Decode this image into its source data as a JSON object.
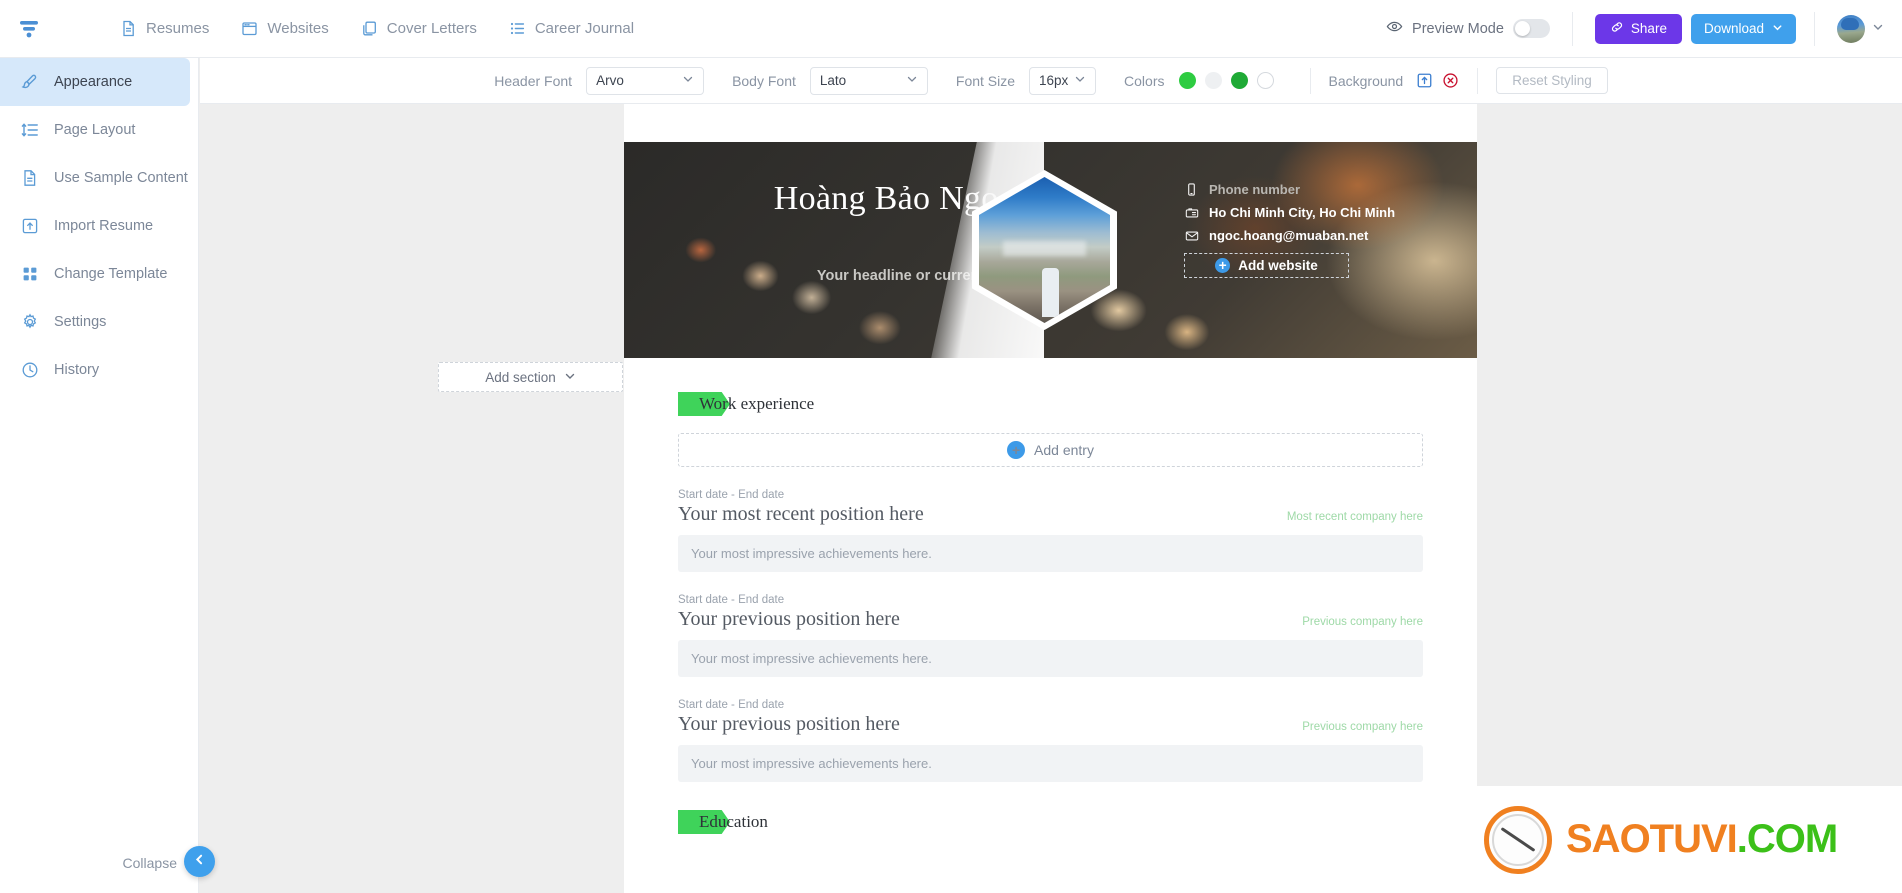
{
  "app": {
    "logo_icon": "funnel-logo-icon"
  },
  "topnav": {
    "items": [
      {
        "label": "Resumes",
        "icon": "document-icon"
      },
      {
        "label": "Websites",
        "icon": "browser-window-icon"
      },
      {
        "label": "Cover Letters",
        "icon": "copy-pages-icon"
      },
      {
        "label": "Career Journal",
        "icon": "list-icon"
      }
    ],
    "preview_mode_label": "Preview Mode",
    "preview_mode_on": false,
    "share_label": "Share",
    "download_label": "Download",
    "share_color": "#6c37e8",
    "download_color": "#3fa0ec"
  },
  "sidebar": {
    "items": [
      {
        "label": "Appearance",
        "icon": "brush-icon",
        "active": true
      },
      {
        "label": "Page Layout",
        "icon": "line-height-icon",
        "active": false
      },
      {
        "label": "Use Sample Content",
        "icon": "document-icon",
        "active": false
      },
      {
        "label": "Import Resume",
        "icon": "upload-box-icon",
        "active": false
      },
      {
        "label": "Change Template",
        "icon": "grid-squares-icon",
        "active": false
      },
      {
        "label": "Settings",
        "icon": "gear-icon",
        "active": false
      },
      {
        "label": "History",
        "icon": "clock-icon",
        "active": false
      }
    ],
    "collapse_label": "Collapse",
    "collapse_icon": "chevron-left-icon",
    "active_bg": "#d6e8fa"
  },
  "styletoolbar": {
    "header_font_label": "Header Font",
    "header_font_value": "Arvo",
    "body_font_label": "Body Font",
    "body_font_value": "Lato",
    "font_size_label": "Font Size",
    "font_size_value": "16px",
    "colors_label": "Colors",
    "swatches": [
      "#2ecc41",
      "#eef0f2",
      "#1faa36",
      "#ffffff"
    ],
    "background_label": "Background",
    "background_upload_icon": "upload-box-icon",
    "background_remove_icon": "remove-circle-icon",
    "reset_label": "Reset Styling"
  },
  "resume": {
    "name": "Hoàng Bảo Ngọc",
    "headline": "Your headline or current title",
    "photo_icon": "hexagon-portrait-photo",
    "contacts": [
      {
        "icon": "phone-icon",
        "text": "Phone number",
        "placeholder": true
      },
      {
        "icon": "location-icon",
        "text": "Ho Chi Minh City, Ho Chi Minh",
        "placeholder": false
      },
      {
        "icon": "envelope-icon",
        "text": "ngoc.hoang@muaban.net",
        "placeholder": false
      }
    ],
    "add_website_label": "Add website",
    "add_section_label": "Add section",
    "add_section_icon": "chevron-down-icon",
    "sections": [
      {
        "title": "Work experience",
        "tag_color": "#3fd35a",
        "add_entry_label": "Add entry",
        "entries": [
          {
            "dates": "Start date - End date",
            "title": "Your most recent position here",
            "company": "Most recent company here",
            "description": "Your most impressive achievements here."
          },
          {
            "dates": "Start date - End date",
            "title": "Your previous position here",
            "company": "Previous company here",
            "description": "Your most impressive achievements here."
          },
          {
            "dates": "Start date - End date",
            "title": "Your previous position here",
            "company": "Previous company here",
            "description": "Your most impressive achievements here."
          }
        ]
      },
      {
        "title": "Education",
        "tag_color": "#3fd35a",
        "add_entry_label": "",
        "entries": []
      }
    ]
  },
  "watermark": {
    "text_part1": "SAOTUVI",
    "text_part2": ".COM",
    "icon": "clock-logo-icon",
    "color1": "#f08020",
    "color2": "#3cc019"
  }
}
